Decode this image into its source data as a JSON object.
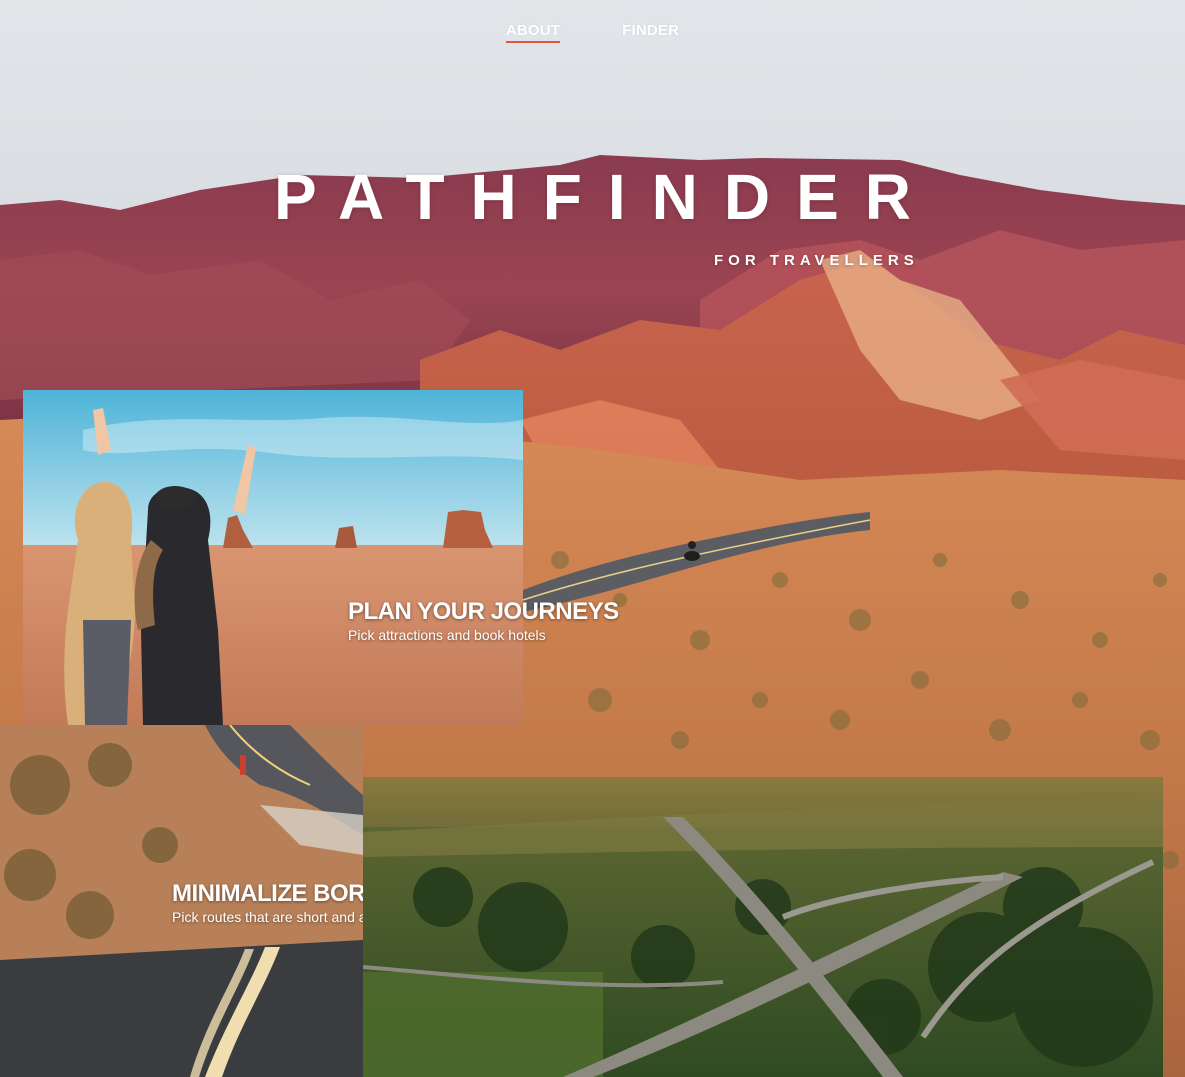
{
  "nav": {
    "items": [
      {
        "label": "ABOUT",
        "active": true
      },
      {
        "label": "FINDER",
        "active": false
      }
    ],
    "active_underline_color": "#e0573c"
  },
  "hero": {
    "title": "PATHFINDER",
    "subtitle": "FOR TRAVELLERS"
  },
  "features": [
    {
      "heading": "PLAN YOUR JOURNEYS",
      "description": "Pick attractions and book hotels"
    },
    {
      "heading": "MINIMALIZE BOREDOM",
      "description": "Pick routes that are short and attractive"
    }
  ],
  "icons": {
    "hero_background": "desert-canyon-photo",
    "card1_photo": "travellers-monument-valley-photo",
    "card2_photo": "desert-road-photo",
    "card3_photo": "aerial-highway-photo"
  }
}
